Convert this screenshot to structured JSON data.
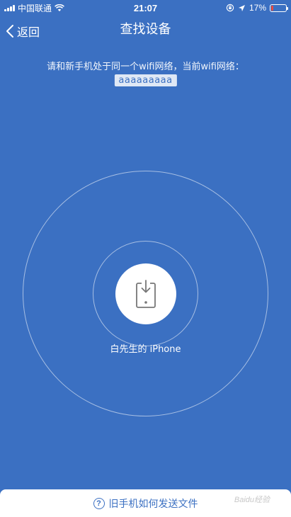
{
  "status_bar": {
    "carrier": "中国联通",
    "time": "21:07",
    "battery_text": "17%",
    "battery_level": 0.17
  },
  "nav": {
    "back_label": "返回",
    "title": "查找设备"
  },
  "instruction": {
    "text": "请和新手机处于同一个wifi网络，当前wifi网络：",
    "wifi_name": "aaaaaaaaa"
  },
  "device": {
    "name": "白先生的 iPhone"
  },
  "help": {
    "icon_glyph": "?",
    "label": "旧手机如何发送文件"
  },
  "watermark": {
    "text": "Baidu经验"
  },
  "colors": {
    "background": "#3b70c2",
    "accent": "#3b70c2",
    "battery_low": "#e84a3f"
  }
}
